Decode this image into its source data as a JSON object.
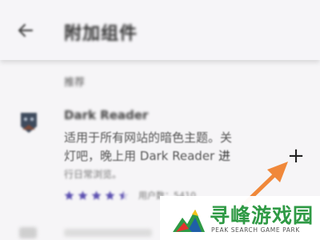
{
  "app_bar": {
    "back_icon": "arrow-back-icon",
    "title": "附加组件"
  },
  "section": {
    "header": "推荐"
  },
  "addon": {
    "icon": "dark-reader-icon",
    "name": "Dark Reader",
    "description_line1": "适用于所有网站的暗色主题。关",
    "description_line2_prefix": "灯吧，晚上用 Dark Reader ",
    "description_line2_end": "进",
    "description_line3": "行日常浏览。",
    "rating_stars": 4.5,
    "rating_max": 5,
    "users_text": "用户数：5410",
    "add_label": "+",
    "add_icon": "plus-icon"
  },
  "annotation": {
    "arrow_color": "#f0883a",
    "arrow_icon": "pointer-arrow-icon"
  },
  "watermark": {
    "title": "寻峰游戏园",
    "subtitle": "PEAK SEARCH GAME PARK",
    "logo_icon": "mountain-logo-icon",
    "brand_color": "#2f9a45"
  }
}
